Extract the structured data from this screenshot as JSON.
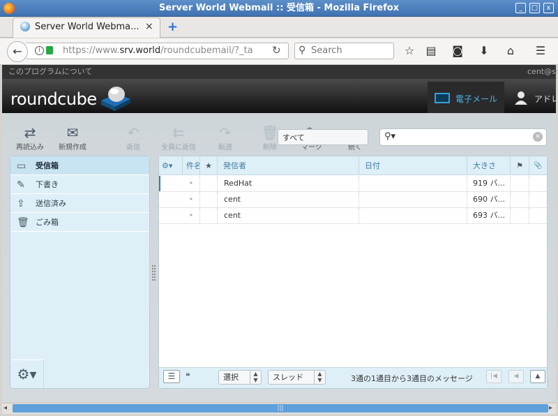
{
  "window": {
    "title": "Server World Webmail :: 受信箱 - Mozilla Firefox",
    "minimize_label": "_",
    "maximize_label": "□",
    "close_label": "x"
  },
  "browser": {
    "tab_title": "Server World Webma...",
    "tab_close": "×",
    "new_tab": "+",
    "url_prefix": "https://www.",
    "url_host": "srv.world",
    "url_path": "/roundcubemail/?_ta",
    "search_placeholder": "Search",
    "icons": [
      "back-icon",
      "info-icon",
      "lock-icon",
      "reload-icon",
      "search-icon",
      "bookmark-star-icon",
      "reader-list-icon",
      "pocket-icon",
      "download-icon",
      "home-icon",
      "hamburger-menu-icon"
    ]
  },
  "app": {
    "about_link": "このプログラムについて",
    "user": "cent@sr",
    "logo": "roundcube",
    "nav": {
      "mail": "電子メール",
      "addressbook": "アドレ"
    }
  },
  "toolbar": {
    "reload": "再読込み",
    "compose": "新規作成",
    "reply": "返信",
    "reply_all": "全員に返信",
    "forward": "転送",
    "delete": "削除",
    "mark": "マーク",
    "more": "続く",
    "filter": "すべて"
  },
  "folders": [
    {
      "label": "受信箱",
      "icon": "inbox-icon",
      "selected": true
    },
    {
      "label": "下書き",
      "icon": "pencil-icon",
      "selected": false
    },
    {
      "label": "送信済み",
      "icon": "sent-icon",
      "selected": false
    },
    {
      "label": "ごみ箱",
      "icon": "trash-icon",
      "selected": false
    }
  ],
  "messagelist": {
    "columns": {
      "options": "⚙",
      "subject": "件名",
      "flag": "★",
      "from": "発信者",
      "date": "日付",
      "size": "大きさ",
      "flagged": "⚑",
      "attachment": "📎"
    },
    "rows": [
      {
        "from": "RedHat",
        "date": "",
        "size": "919 バ..."
      },
      {
        "from": "cent",
        "date": "",
        "size": "690 バ..."
      },
      {
        "from": "cent",
        "date": "",
        "size": "693 バ..."
      }
    ],
    "footer": {
      "select": "選択",
      "threads": "スレッド",
      "count": "3通の1通目から3通目のメッセージ"
    }
  },
  "colors": {
    "accent": "#3d7ca3",
    "folder_bg": "#dfeff7",
    "header_dark": "#1a1a1a"
  }
}
